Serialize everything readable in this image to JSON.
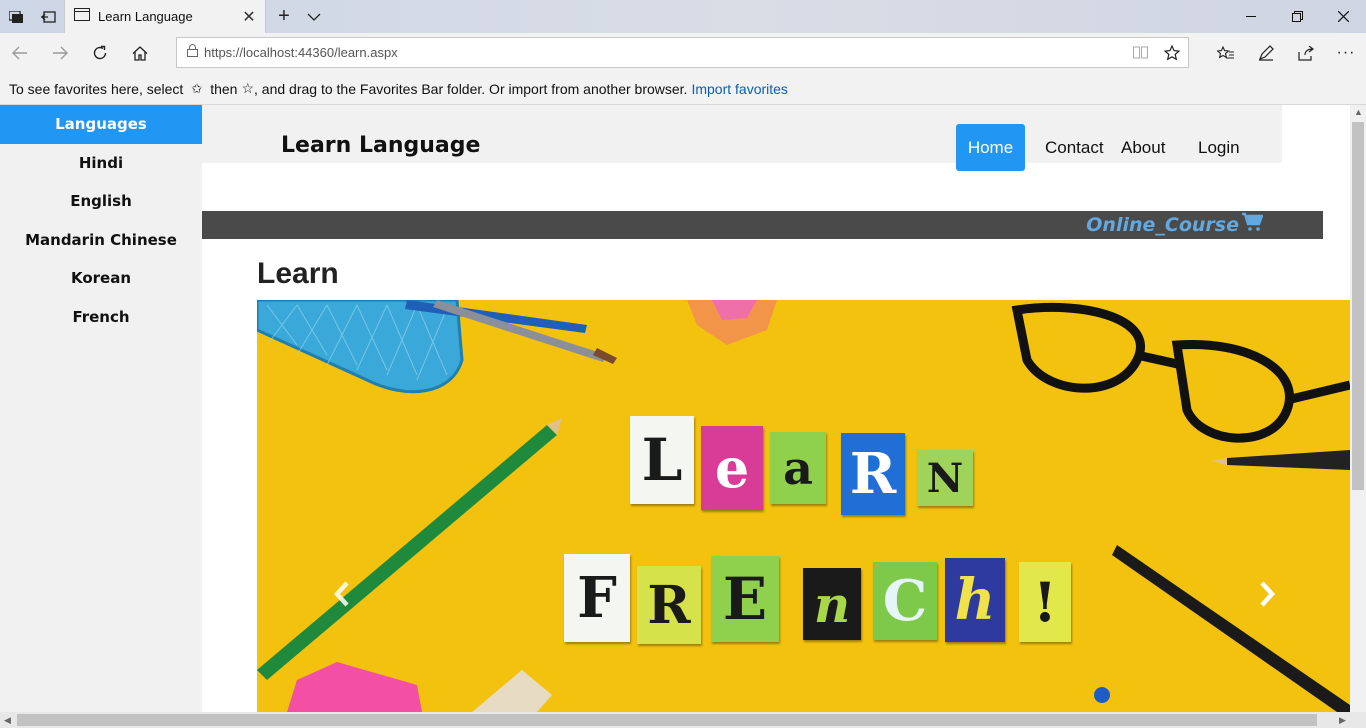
{
  "browser": {
    "tab_title": "Learn Language",
    "url": "https://localhost:44360/learn.aspx",
    "favbar_text_1": "To see favorites here, select",
    "favbar_text_2": "then",
    "favbar_text_3": ", and drag to the Favorites Bar folder. Or import from another browser.",
    "favbar_link": "Import favorites"
  },
  "sidebar": {
    "items": [
      {
        "label": "Languages"
      },
      {
        "label": "Hindi"
      },
      {
        "label": "English"
      },
      {
        "label": "Mandarin Chinese"
      },
      {
        "label": "Korean"
      },
      {
        "label": "French"
      }
    ],
    "active_color": "#2196f3"
  },
  "header": {
    "brand": "Learn Language",
    "nav": {
      "home": "Home",
      "contact": "Contact",
      "about": "About",
      "login": "Login"
    }
  },
  "banner": {
    "course": "Online_Course",
    "course_color": "#63a8de"
  },
  "main": {
    "heading": "Learn"
  },
  "carousel": {
    "line1": [
      "L",
      "e",
      "a",
      "R",
      "N"
    ],
    "line2": [
      "F",
      "R",
      "E",
      "n",
      "C",
      "h",
      "!"
    ]
  }
}
